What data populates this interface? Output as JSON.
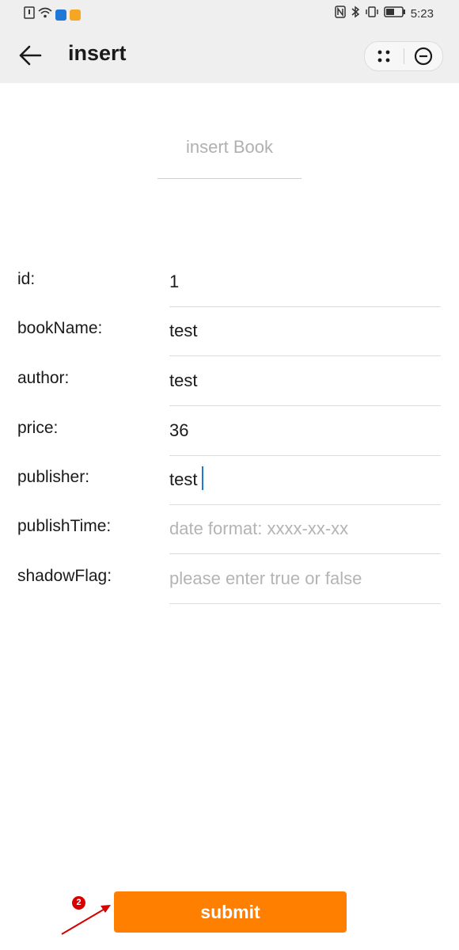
{
  "status_bar": {
    "left_icons": [
      "sim-icon",
      "wifi-icon",
      "app-blue-icon",
      "app-yellow-icon"
    ],
    "right_icons": [
      "nfc-icon",
      "bluetooth-icon",
      "vibrate-icon",
      "battery-icon"
    ],
    "time": "5:23"
  },
  "nav": {
    "title": "insert",
    "capsule_icons": [
      "more-dots-icon",
      "close-circle-icon"
    ]
  },
  "header_field": {
    "placeholder": "insert Book"
  },
  "form": {
    "fields": [
      {
        "label": "id:",
        "value": "1",
        "placeholder": ""
      },
      {
        "label": "bookName:",
        "value": "test",
        "placeholder": ""
      },
      {
        "label": "author:",
        "value": "test",
        "placeholder": ""
      },
      {
        "label": "price:",
        "value": "36",
        "placeholder": ""
      },
      {
        "label": "publisher:",
        "value": "test",
        "placeholder": ""
      },
      {
        "label": "publishTime:",
        "value": "",
        "placeholder": "date format: xxxx-xx-xx"
      },
      {
        "label": "shadowFlag:",
        "value": "",
        "placeholder": "please enter true or false"
      }
    ],
    "focused_field": "publisher"
  },
  "submit": {
    "label": "submit"
  },
  "annotation": {
    "badge": "2"
  },
  "colors": {
    "accent": "#ff7f00",
    "bar_bg": "#efefef",
    "caret": "#1e78d6",
    "marker": "#d50000"
  }
}
